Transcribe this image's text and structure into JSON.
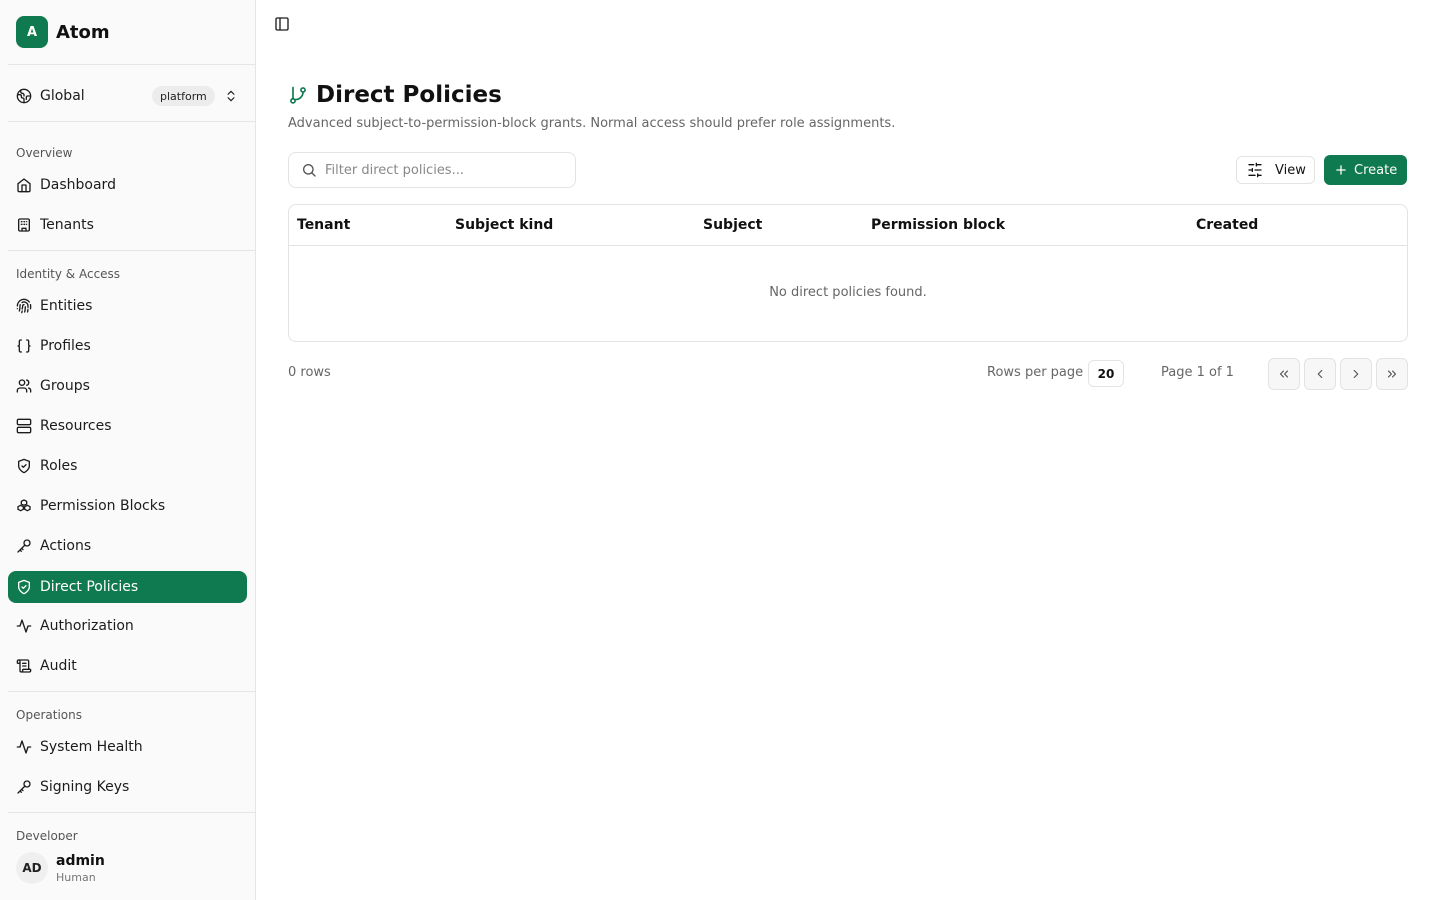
{
  "brand": {
    "logo_letter": "A",
    "name": "Atom"
  },
  "scope": {
    "label": "Global",
    "badge": "platform"
  },
  "sections": {
    "overview": "Overview",
    "identity": "Identity & Access",
    "operations": "Operations",
    "developer": "Developer"
  },
  "nav": {
    "dashboard": "Dashboard",
    "tenants": "Tenants",
    "entities": "Entities",
    "profiles": "Profiles",
    "groups": "Groups",
    "resources": "Resources",
    "roles": "Roles",
    "permission_blocks": "Permission Blocks",
    "actions": "Actions",
    "direct_policies": "Direct Policies",
    "authorization": "Authorization",
    "audit": "Audit",
    "system_health": "System Health",
    "signing_keys": "Signing Keys"
  },
  "user": {
    "initials": "AD",
    "name": "admin",
    "kind": "Human"
  },
  "page": {
    "title": "Direct Policies",
    "subtitle": "Advanced subject-to-permission-block grants. Normal access should prefer role assignments."
  },
  "filter": {
    "placeholder": "Filter direct policies...",
    "value": ""
  },
  "toolbar": {
    "view_label": "View",
    "create_label": "Create"
  },
  "table": {
    "columns": [
      "Tenant",
      "Subject kind",
      "Subject",
      "Permission block",
      "Created"
    ],
    "rows": [],
    "empty_text": "No direct policies found."
  },
  "pagination": {
    "row_count": "0 rows",
    "rows_per_page_label": "Rows per page",
    "rows_per_page": "20",
    "page_info": "Page 1 of 1"
  },
  "colors": {
    "accent": "#0f7a4f"
  },
  "icons": {
    "brand": "A-logo",
    "scope": "globe-icon",
    "active_page": "git-branch-icon"
  }
}
